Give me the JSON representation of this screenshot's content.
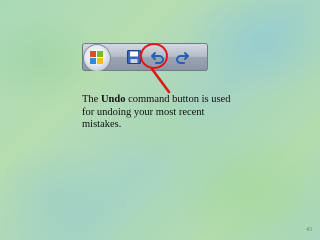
{
  "toolbar": {
    "icons": [
      "office-button-icon",
      "save-icon",
      "undo-icon",
      "redo-icon"
    ],
    "highlighted": "undo-icon"
  },
  "caption": {
    "prefix": "The ",
    "emphasis": "Undo",
    "rest": " command button is used for undoing your most recent mistakes."
  },
  "slide": {
    "page_number": "43"
  },
  "colors": {
    "highlight": "#e01818",
    "text": "#111111"
  }
}
